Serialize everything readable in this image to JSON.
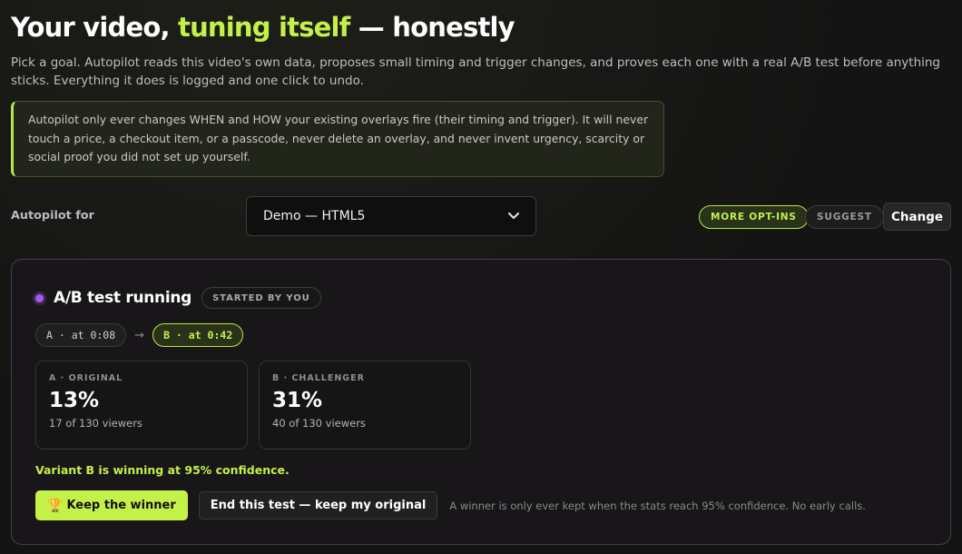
{
  "header": {
    "title_part1": "Your video, ",
    "title_accent": "tuning itself",
    "title_part2": " — honestly",
    "subtitle": "Pick a goal. Autopilot reads this video's own data, proposes small timing and trigger changes, and proves each one with a real A/B test before anything sticks. Everything it does is logged and one click to undo."
  },
  "notice": {
    "text": "Autopilot only ever changes WHEN and HOW your existing overlays fire (their timing and trigger). It will never touch a price, a checkout item, or a passcode, never delete an overlay, and never invent urgency, scarcity or social proof you did not set up yourself."
  },
  "controls": {
    "label": "Autopilot for",
    "select_value": "Demo — HTML5",
    "select_icon": "chevron-down-icon",
    "pill_more_optins": "MORE OPT-INS",
    "pill_suggest": "SUGGEST",
    "change_button": "Change"
  },
  "test": {
    "status_color": "#a55ae8",
    "title": "A/B test running",
    "badge": "STARTED BY YOU",
    "variant_a_chip": "A · at 0:08",
    "arrow": "→",
    "variant_b_chip": "B · at 0:42",
    "cards": [
      {
        "label": "A · ORIGINAL",
        "value": "13%",
        "sub": "17 of 130 viewers"
      },
      {
        "label": "B · CHALLENGER",
        "value": "31%",
        "sub": "40 of 130 viewers"
      }
    ],
    "winning_text": "Variant B is winning at 95% confidence.",
    "keep_icon": "trophy-icon",
    "keep_button": "Keep the winner",
    "end_button": "End this test — keep my original",
    "note": "A winner is only ever kept when the stats reach 95% confidence. No early calls."
  },
  "colors": {
    "accent": "#c4f04a",
    "background": "#141414",
    "card_border": "#4a3a52"
  }
}
